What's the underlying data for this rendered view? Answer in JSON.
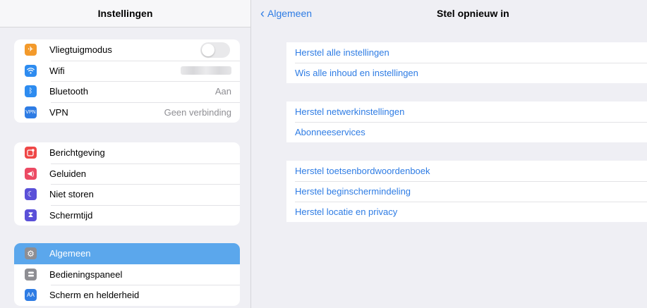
{
  "sidebar": {
    "title": "Instellingen",
    "groups": [
      [
        {
          "label": "Vliegtuigmodus",
          "icon": "airplane-icon",
          "color": "#f39a2b",
          "control": "toggle"
        },
        {
          "label": "Wifi",
          "icon": "wifi-icon",
          "color": "#2e8cf0",
          "control": "blurred"
        },
        {
          "label": "Bluetooth",
          "icon": "bluetooth-icon",
          "color": "#2e8cf0",
          "value": "Aan"
        },
        {
          "label": "VPN",
          "icon": "vpn-icon",
          "color": "#2e7ce4",
          "value": "Geen verbinding",
          "icon_text": "VPN"
        }
      ],
      [
        {
          "label": "Berichtgeving",
          "icon": "notifications-icon",
          "color": "#ef4747"
        },
        {
          "label": "Geluiden",
          "icon": "sound-icon",
          "color": "#ec4a63"
        },
        {
          "label": "Niet storen",
          "icon": "moon-icon",
          "color": "#5a50d8"
        },
        {
          "label": "Schermtijd",
          "icon": "hourglass-icon",
          "color": "#5a50d8"
        }
      ],
      [
        {
          "label": "Algemeen",
          "icon": "gear-icon",
          "color": "#8e8e93",
          "selected": true
        },
        {
          "label": "Bedieningspaneel",
          "icon": "control-center-icon",
          "color": "#8e8e93"
        },
        {
          "label": "Scherm en helderheid",
          "icon": "display-icon",
          "color": "#2e7ce4",
          "icon_text": "AA"
        }
      ]
    ]
  },
  "nav": {
    "back_label": "Algemeen",
    "title": "Stel opnieuw in"
  },
  "reset_groups": [
    [
      "Herstel alle instellingen",
      "Wis alle inhoud en instellingen"
    ],
    [
      "Herstel netwerkinstellingen",
      "Abonneeservices"
    ],
    [
      "Herstel toetsenbordwoordenboek",
      "Herstel beginschermindeling",
      "Herstel locatie en privacy"
    ]
  ],
  "colors": {
    "accent": "#2e7ce4",
    "selected_row": "#5ba7ec",
    "background": "#efeff4"
  }
}
